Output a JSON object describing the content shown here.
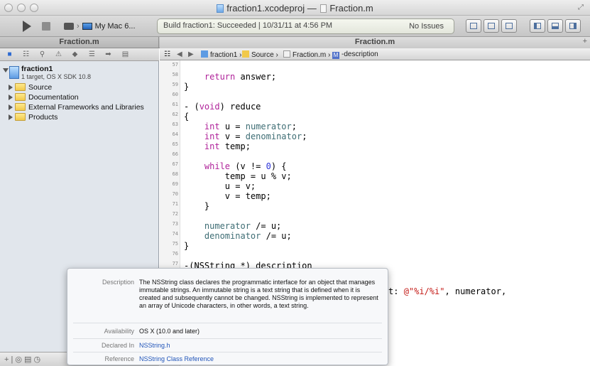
{
  "window": {
    "title_project": "fraction1.xcodeproj",
    "title_separator": "—",
    "title_file": "Fraction.m"
  },
  "toolbar": {
    "scheme_target": "My Mac 6...",
    "activity_status": "Build fraction1: Succeeded | 10/31/11 at 4:56 PM",
    "issues": "No Issues"
  },
  "tabs": {
    "navigator_tab": "Fraction.m",
    "editor_tab": "Fraction.m",
    "new_tab": "+"
  },
  "navigator": {
    "project_name": "fraction1",
    "project_subtitle": "1 target, OS X SDK 10.8",
    "items": [
      {
        "label": "Source"
      },
      {
        "label": "Documentation"
      },
      {
        "label": "External Frameworks and Libraries"
      },
      {
        "label": "Products"
      }
    ],
    "bottom_bar": "+ | ◎ ▤ ◷"
  },
  "jumpbar": {
    "crumbs": [
      "fraction1",
      "Source",
      "Fraction.m",
      "-description"
    ],
    "method_badge": "M"
  },
  "editor": {
    "line_numbers": [
      "57",
      "58",
      "59",
      "60",
      "61",
      "62",
      "63",
      "64",
      "65",
      "66",
      "67",
      "68",
      "69",
      "70",
      "71",
      "72",
      "73",
      "74",
      "75",
      "76",
      "77"
    ],
    "visible_tail": ": @\"%i/%i\", numerator,"
  },
  "quick_help": {
    "rows": [
      {
        "label": "Description",
        "value": "The NSString class declares the programmatic interface for an object that manages immutable strings. An immutable string is a text string that is defined when it is created and subsequently cannot be changed. NSString is implemented to represent an array of Unicode characters, in other words, a text string."
      },
      {
        "label": "Availability",
        "value": "OS X (10.0 and later)"
      },
      {
        "label": "Declared In",
        "value": "NSString.h"
      },
      {
        "label": "Reference",
        "value": "NSString Class Reference"
      }
    ]
  },
  "colors": {
    "keyword": "#b0239a",
    "ivar": "#3e6d74",
    "number": "#2d34d8",
    "string": "#c41a16",
    "link": "#2155b9"
  }
}
